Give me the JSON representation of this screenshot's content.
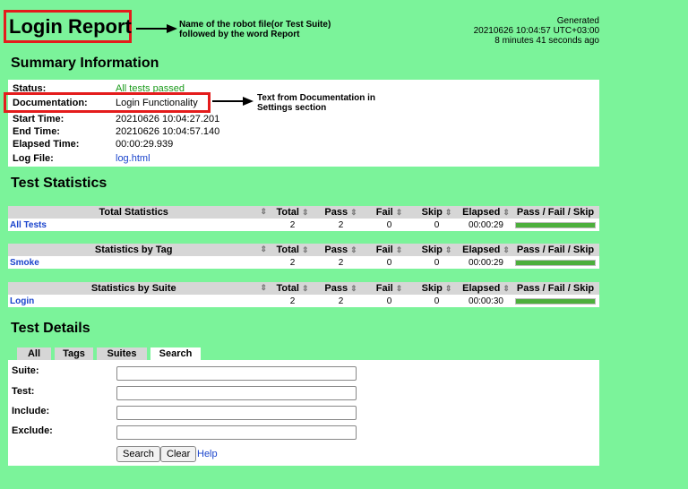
{
  "header": {
    "title": "Login Report",
    "annotation_line1": "Name of the robot file(or Test Suite)",
    "annotation_line2": "followed by the word Report",
    "generated_label": "Generated",
    "generated_time": "20210626 10:04:57 UTC+03:00",
    "generated_ago": "8 minutes 41 seconds ago"
  },
  "summary": {
    "heading": "Summary Information",
    "status_label": "Status:",
    "status_value": "All tests passed",
    "documentation_label": "Documentation:",
    "documentation_value": "Login Functionality",
    "start_label": "Start Time:",
    "start_value": "20210626 10:04:27.201",
    "end_label": "End Time:",
    "end_value": "20210626 10:04:57.140",
    "elapsed_label": "Elapsed Time:",
    "elapsed_value": "00:00:29.939",
    "log_label": "Log File:",
    "log_value": "log.html",
    "doc_annotation_line1": "Text from Documentation in",
    "doc_annotation_line2": "Settings section"
  },
  "statistics": {
    "heading": "Test Statistics",
    "columns": {
      "total": "Total",
      "pass": "Pass",
      "fail": "Fail",
      "skip": "Skip",
      "elapsed": "Elapsed",
      "graph": "Pass / Fail / Skip"
    },
    "tables": [
      {
        "title": "Total Statistics",
        "row": {
          "name": "All Tests",
          "total": "2",
          "pass": "2",
          "fail": "0",
          "skip": "0",
          "elapsed": "00:00:29",
          "pass_fraction": 1.0
        }
      },
      {
        "title": "Statistics by Tag",
        "row": {
          "name": "Smoke",
          "total": "2",
          "pass": "2",
          "fail": "0",
          "skip": "0",
          "elapsed": "00:00:29",
          "pass_fraction": 1.0
        }
      },
      {
        "title": "Statistics by Suite",
        "row": {
          "name": "Login",
          "total": "2",
          "pass": "2",
          "fail": "0",
          "skip": "0",
          "elapsed": "00:00:30",
          "pass_fraction": 1.0
        }
      }
    ]
  },
  "details": {
    "heading": "Test Details",
    "tabs": [
      "All",
      "Tags",
      "Suites",
      "Search"
    ],
    "active_tab": "Search",
    "suite_label": "Suite:",
    "test_label": "Test:",
    "include_label": "Include:",
    "exclude_label": "Exclude:",
    "search_button": "Search",
    "clear_button": "Clear",
    "help_link": "Help"
  },
  "colors": {
    "background": "#7bf39a",
    "highlight_border": "#e41c1c",
    "pass_bar": "#4caf3c",
    "link": "#1a44cc"
  }
}
